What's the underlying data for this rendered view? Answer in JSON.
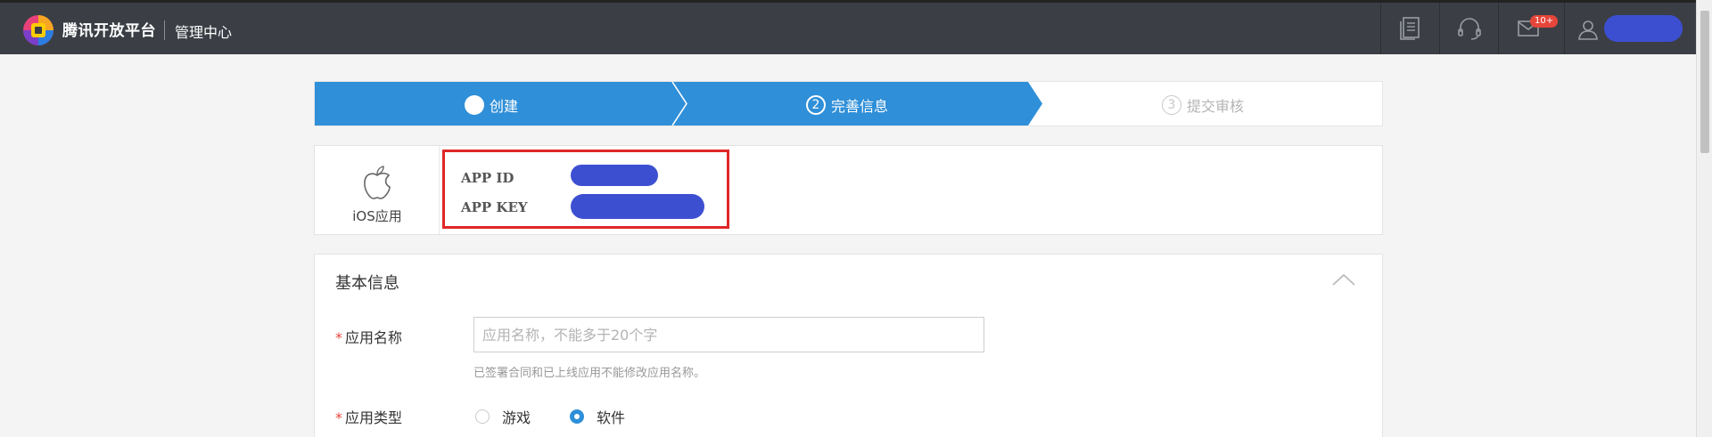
{
  "header": {
    "brand": "腾讯开放平台",
    "subtitle": "管理中心",
    "icons": [
      "docs-icon",
      "support-headset-icon",
      "mail-icon",
      "user-icon"
    ],
    "mail_badge": "10+"
  },
  "steps": [
    {
      "number": "",
      "label": "创建",
      "state": "done"
    },
    {
      "number": "2",
      "label": "完善信息",
      "state": "active"
    },
    {
      "number": "3",
      "label": "提交审核",
      "state": "pending"
    }
  ],
  "app": {
    "type_label": "iOS应用",
    "app_id_label": "APP ID",
    "app_key_label": "APP KEY"
  },
  "basic_info": {
    "title": "基本信息",
    "required_mark": "*",
    "name_label": "应用名称",
    "name_value": "",
    "name_placeholder": "应用名称，不能多于20个字",
    "name_hint": "已签署合同和已上线应用不能修改应用名称。",
    "type_label": "应用类型",
    "type_options": [
      "游戏",
      "软件"
    ],
    "type_selected": "软件"
  },
  "colors": {
    "topbar": "#3b3f45",
    "step_active": "#2f8fd8",
    "highlight": "#e02727",
    "required": "#e5453a",
    "redacted": "#3d4fd1"
  }
}
